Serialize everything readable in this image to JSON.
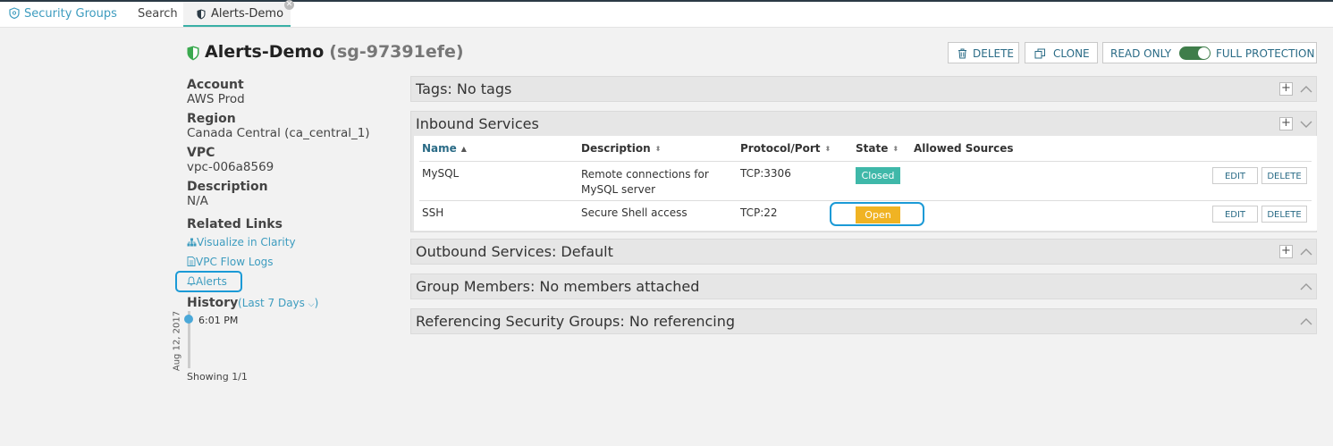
{
  "tabs": {
    "security_groups": "Security Groups",
    "search": "Search",
    "active": "Alerts-Demo"
  },
  "header": {
    "name": "Alerts-Demo",
    "sg_id": "(sg-97391efe)",
    "delete_label": "DELETE",
    "clone_label": "CLONE",
    "read_only_label": "READ ONLY",
    "full_protection_label": "FULL PROTECTION",
    "toggle_on": true
  },
  "details": {
    "account_label": "Account",
    "account_value": "AWS Prod",
    "region_label": "Region",
    "region_value": "Canada Central (ca_central_1)",
    "vpc_label": "VPC",
    "vpc_value": "vpc-006a8569",
    "description_label": "Description",
    "description_value": "N/A",
    "related_links_label": "Related Links",
    "links": [
      "Visualize in Clarity",
      "VPC Flow Logs",
      "Alerts"
    ],
    "history_label": "History",
    "history_range": "Last 7 Days",
    "history_date": "Aug 12, 2017",
    "history_time": "6:01 PM",
    "showing": "Showing 1/1"
  },
  "panels": {
    "tags": "Tags: No tags",
    "inbound": "Inbound Services",
    "outbound": "Outbound Services: Default",
    "members": "Group Members: No members attached",
    "referencing": "Referencing Security Groups: No referencing"
  },
  "inbound_table": {
    "columns": [
      "Name",
      "Description",
      "Protocol/Port",
      "State",
      "Allowed Sources"
    ],
    "rows": [
      {
        "name": "MySQL",
        "description_line1": "Remote connections for",
        "description_line2": "MySQL server",
        "protocol": "TCP:3306",
        "state": "Closed",
        "edit": "EDIT",
        "delete": "DELETE"
      },
      {
        "name": "SSH",
        "description_line1": "Secure Shell access",
        "description_line2": "",
        "protocol": "TCP:22",
        "state": "Open",
        "edit": "EDIT",
        "delete": "DELETE"
      }
    ]
  },
  "colors": {
    "accent": "#3d9cbf",
    "closed": "#3fb8a9",
    "open": "#f0b323",
    "highlight": "#1b9ad6",
    "shield": "#3aa94f",
    "toggle": "#3f7d4a"
  }
}
